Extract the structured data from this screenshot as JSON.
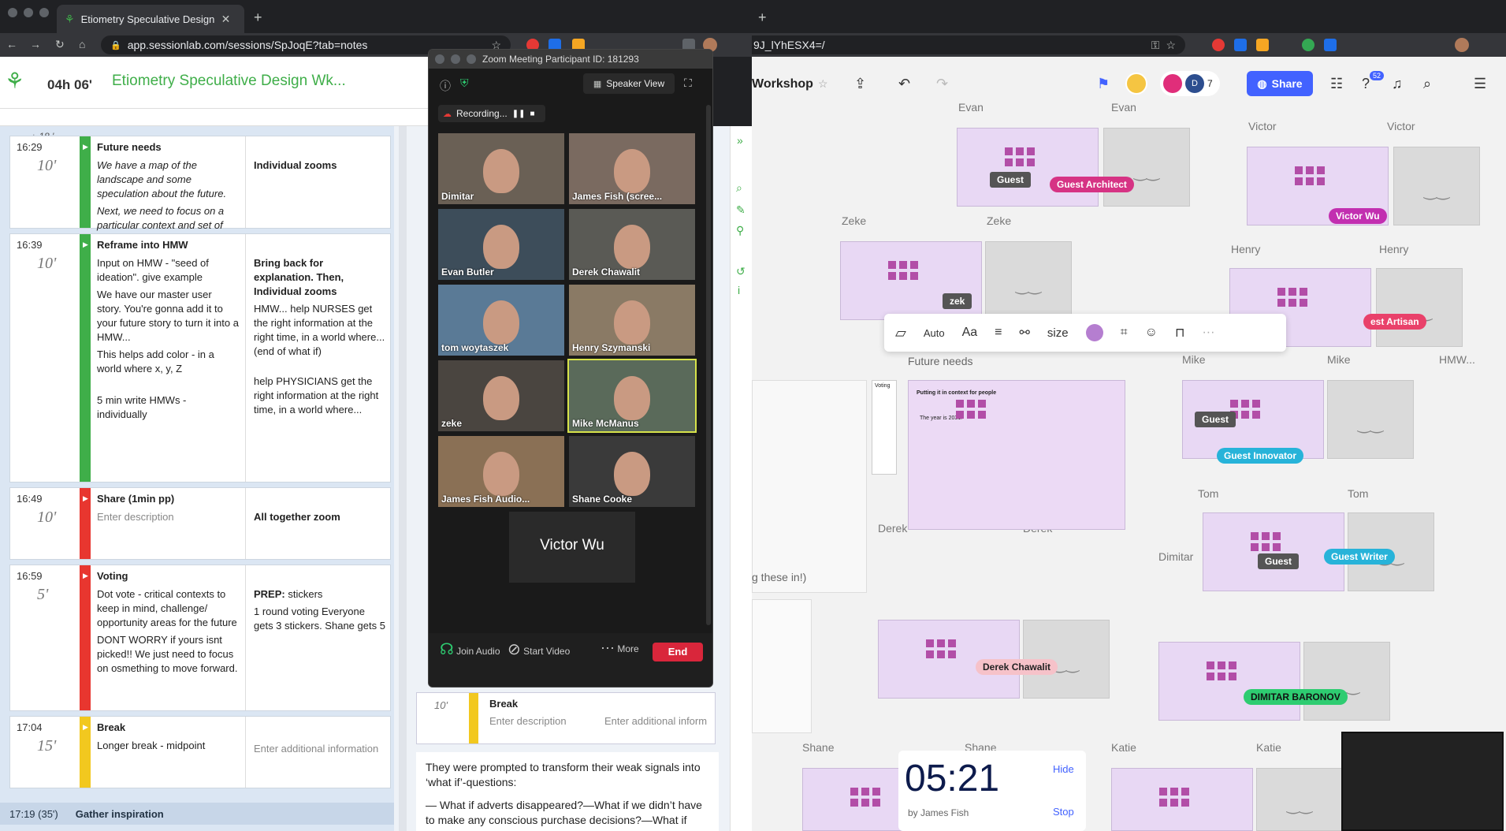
{
  "browser_left": {
    "tab_title": "Etiometry Speculative Design W",
    "url": "app.sessionlab.com/sessions/SpJoqE?tab=notes"
  },
  "browser_right": {
    "url": "9J_lYhESX4=/"
  },
  "sessionlab": {
    "clock": "04h 06'",
    "session_title": "Etiometry Speculative Design Wk...",
    "gap_label": "↓ 18 '",
    "blocks": [
      {
        "time": "16:29",
        "duration": "10'",
        "title": "Future needs",
        "color": "#3fae49",
        "desc": [
          "We have a map of the landscape and some speculation about the future.",
          "Next, we need to focus on a particular context and set of people - and their concrete needs - to solve for."
        ],
        "notes_bold": "Individual zooms",
        "notes": []
      },
      {
        "time": "16:39",
        "duration": "10'",
        "title": "Reframe into HMW",
        "color": "#3fae49",
        "desc": [
          "Input on HMW - \"seed of ideation\". give example",
          "We have our master user story. You're gonna add it to your future story to turn it into a HMW...",
          "This helps add color - in a world where x, y, Z",
          "5 min write HMWs - individually"
        ],
        "notes_bold": "Bring back for explanation. Then, Individual zooms",
        "notes": [
          "HMW... help NURSES get the right information at the right time, in a world where...(end of what if)",
          "help PHYSICIANS get the right information at the right time, in a world where..."
        ]
      },
      {
        "time": "16:49",
        "duration": "10'",
        "title": "Share (1min pp)",
        "color": "#e8362f",
        "desc": [
          "Enter description"
        ],
        "notes_bold": "All together zoom",
        "notes": []
      },
      {
        "time": "16:59",
        "duration": "5'",
        "title": "Voting",
        "color": "#e8362f",
        "desc": [
          "Dot vote - critical contexts to keep in mind, challenge/ opportunity areas for the future",
          "DONT WORRY if yours isnt picked!! We just need to focus on osmething to move forward."
        ],
        "notes_bold": "PREP:",
        "notes_tail": " stickers",
        "notes": [
          "1 round voting Everyone gets 3 stickers. Shane gets 5"
        ]
      },
      {
        "time": "17:04",
        "duration": "15'",
        "title": "Break",
        "color": "#f2c81f",
        "desc": [
          "Longer break - midpoint"
        ],
        "notes_bold": "",
        "notes": [
          "Enter additional information"
        ]
      }
    ],
    "section": {
      "time": "17:19 (35')",
      "title": "Gather inspiration"
    },
    "right_panel": {
      "break_duration": "10'",
      "break_title": "Break",
      "break_desc": "Enter description",
      "break_info": "Enter additional inform",
      "text1": "They were prompted to transform their weak signals into ‘what if’-questions:",
      "text2": "— What if adverts disappeared?—What if we didn’t have to make any conscious purchase decisions?—What if"
    }
  },
  "zoom": {
    "title": "Zoom Meeting Participant ID: 181293",
    "view": "Speaker View",
    "recording": "Recording...",
    "participants": [
      "Dimitar",
      "James Fish (scree...",
      "Evan Butler",
      "Derek Chawalit",
      "tom woytaszek",
      "Henry Szymanski",
      "zeke",
      "Mike McManus",
      "James Fish Audio...",
      "Shane Cooke"
    ],
    "speaker": "Victor Wu",
    "controls": {
      "audio": "Join Audio",
      "video": "Start Video",
      "more": "More",
      "end": "End"
    }
  },
  "miro": {
    "board_title": "Workshop",
    "share": "Share",
    "collab_count": "7",
    "notif": "52",
    "names": [
      "Evan",
      "Evan",
      "Victor",
      "Victor",
      "Zeke",
      "Zeke",
      "Henry",
      "Henry",
      "Mike",
      "Mike",
      "HMW...",
      "Tom",
      "Tom",
      "Derek",
      "Derek",
      "Dimitar",
      "Dimitar",
      "Shane",
      "Shane",
      "Katie",
      "Katie"
    ],
    "future_needs": "Future needs",
    "cursors": [
      {
        "name": "Guest Architect",
        "color": "#d63384"
      },
      {
        "name": "Victor Wu",
        "color": "#c22fb0"
      },
      {
        "name": "est Artisan",
        "color": "#e9416a"
      },
      {
        "name": "Guest Innovator",
        "color": "#27b3d9"
      },
      {
        "name": "Guest Writer",
        "color": "#27b3d9"
      },
      {
        "name": "Derek Chawalit",
        "color": "#f6c2c9"
      },
      {
        "name": "DIMITAR BARONOV",
        "color": "#2ecc71"
      }
    ],
    "guest": "Guest",
    "toolbar": {
      "auto": "Auto",
      "aa": "Aa",
      "size": "size"
    },
    "timer": {
      "value": "05:21",
      "by": "by James Fish",
      "hide": "Hide",
      "stop": "Stop"
    },
    "voting_label": "Voting",
    "frame_heading": "Putting it in context for people",
    "frame_text": "The year is 2031.",
    "frame_note": "g these in!)",
    "zeke_cursor": "zek"
  }
}
